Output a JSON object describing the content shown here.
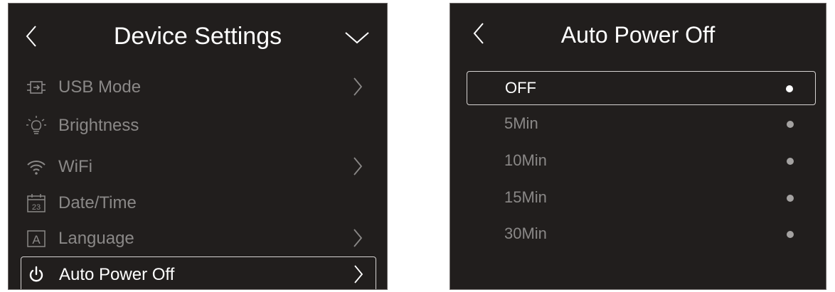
{
  "device_settings": {
    "title": "Device Settings",
    "items": [
      {
        "label": "USB Mode",
        "icon": "usb-mode-icon",
        "has_arrow": true
      },
      {
        "label": "Brightness",
        "icon": "brightness-icon",
        "has_arrow": false
      },
      {
        "label": "WiFi",
        "icon": "wifi-icon",
        "has_arrow": true
      },
      {
        "label": "Date/Time",
        "icon": "calendar-icon",
        "icon_text": "23",
        "has_arrow": false
      },
      {
        "label": "Language",
        "icon": "language-icon",
        "icon_text": "A",
        "has_arrow": true
      },
      {
        "label": "Auto Power Off",
        "icon": "power-icon",
        "has_arrow": true,
        "selected": true
      }
    ]
  },
  "auto_power_off": {
    "title": "Auto Power Off",
    "options": [
      {
        "label": "OFF",
        "selected": true
      },
      {
        "label": "5Min",
        "selected": false
      },
      {
        "label": "10Min",
        "selected": false
      },
      {
        "label": "15Min",
        "selected": false
      },
      {
        "label": "30Min",
        "selected": false
      }
    ]
  },
  "colors": {
    "background": "#211e1d",
    "text_active": "#ffffff",
    "text_inactive": "#8a8887",
    "selection_border": "#d6d3d2"
  }
}
